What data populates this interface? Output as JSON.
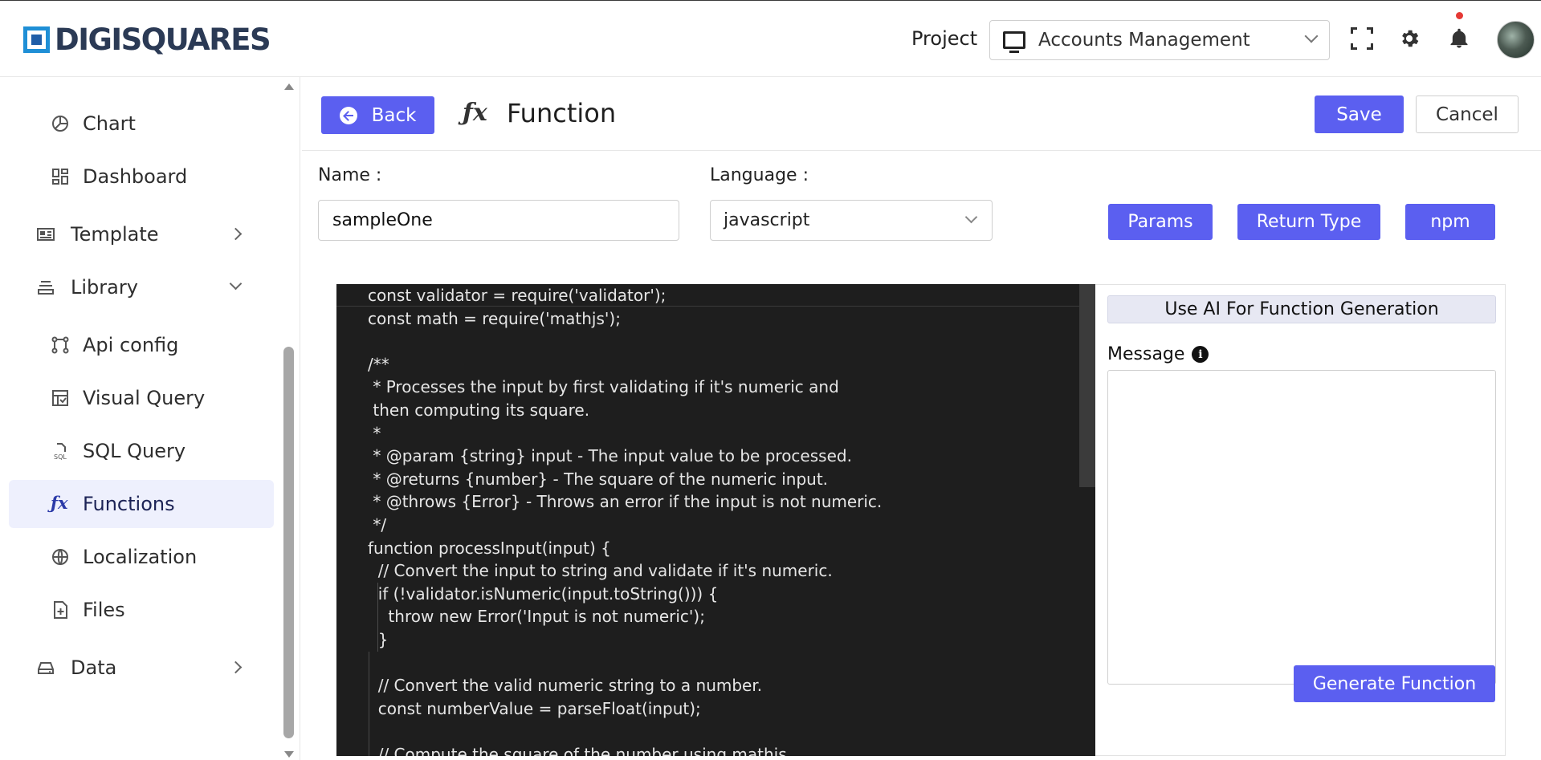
{
  "header": {
    "logo_text": "DIGISQUARES",
    "project_label": "Project",
    "project_value": "Accounts Management",
    "icons": [
      "fullscreen-icon",
      "gear-icon",
      "bell-icon"
    ]
  },
  "sidebar": {
    "items": [
      {
        "label": "Chart",
        "icon": "chart-pie-icon"
      },
      {
        "label": "Dashboard",
        "icon": "dashboard-icon"
      },
      {
        "label": "Template",
        "icon": "template-icon"
      },
      {
        "label": "Library",
        "icon": "library-icon"
      },
      {
        "label": "Api config",
        "icon": "api-config-icon"
      },
      {
        "label": "Visual Query",
        "icon": "visual-query-icon"
      },
      {
        "label": "SQL Query",
        "icon": "sql-query-icon"
      },
      {
        "label": "Functions",
        "icon": "fx-icon"
      },
      {
        "label": "Localization",
        "icon": "globe-icon"
      },
      {
        "label": "Files",
        "icon": "file-add-icon"
      },
      {
        "label": "Data",
        "icon": "data-drive-icon"
      }
    ],
    "active": "Functions"
  },
  "toolbar": {
    "back_label": "Back",
    "title": "Function",
    "save_label": "Save",
    "cancel_label": "Cancel"
  },
  "form": {
    "name_label": "Name :",
    "name_value": "sampleOne",
    "language_label": "Language :",
    "language_value": "javascript",
    "params_label": "Params",
    "return_type_label": "Return Type",
    "npm_label": "npm"
  },
  "editor": {
    "lines": [
      "const validator = require('validator');",
      "const math = require('mathjs');",
      "",
      "/**",
      " * Processes the input by first validating if it's numeric and",
      " then computing its square.",
      " *",
      " * @param {string} input - The input value to be processed.",
      " * @returns {number} - The square of the numeric input.",
      " * @throws {Error} - Throws an error if the input is not numeric.",
      " */",
      "function processInput(input) {",
      "  // Convert the input to string and validate if it's numeric.",
      "  if (!validator.isNumeric(input.toString())) {",
      "    throw new Error('Input is not numeric');",
      "  }",
      "",
      "  // Convert the valid numeric string to a number.",
      "  const numberValue = parseFloat(input);",
      "",
      "  // Compute the square of the number using mathjs"
    ]
  },
  "ai_panel": {
    "heading": "Use AI For Function Generation",
    "message_label": "Message",
    "message_value": "",
    "generate_label": "Generate Function"
  },
  "colors": {
    "accent": "#5b5ff0",
    "editor_bg": "#1e1e1e",
    "active_nav_bg": "#eef0fd"
  }
}
